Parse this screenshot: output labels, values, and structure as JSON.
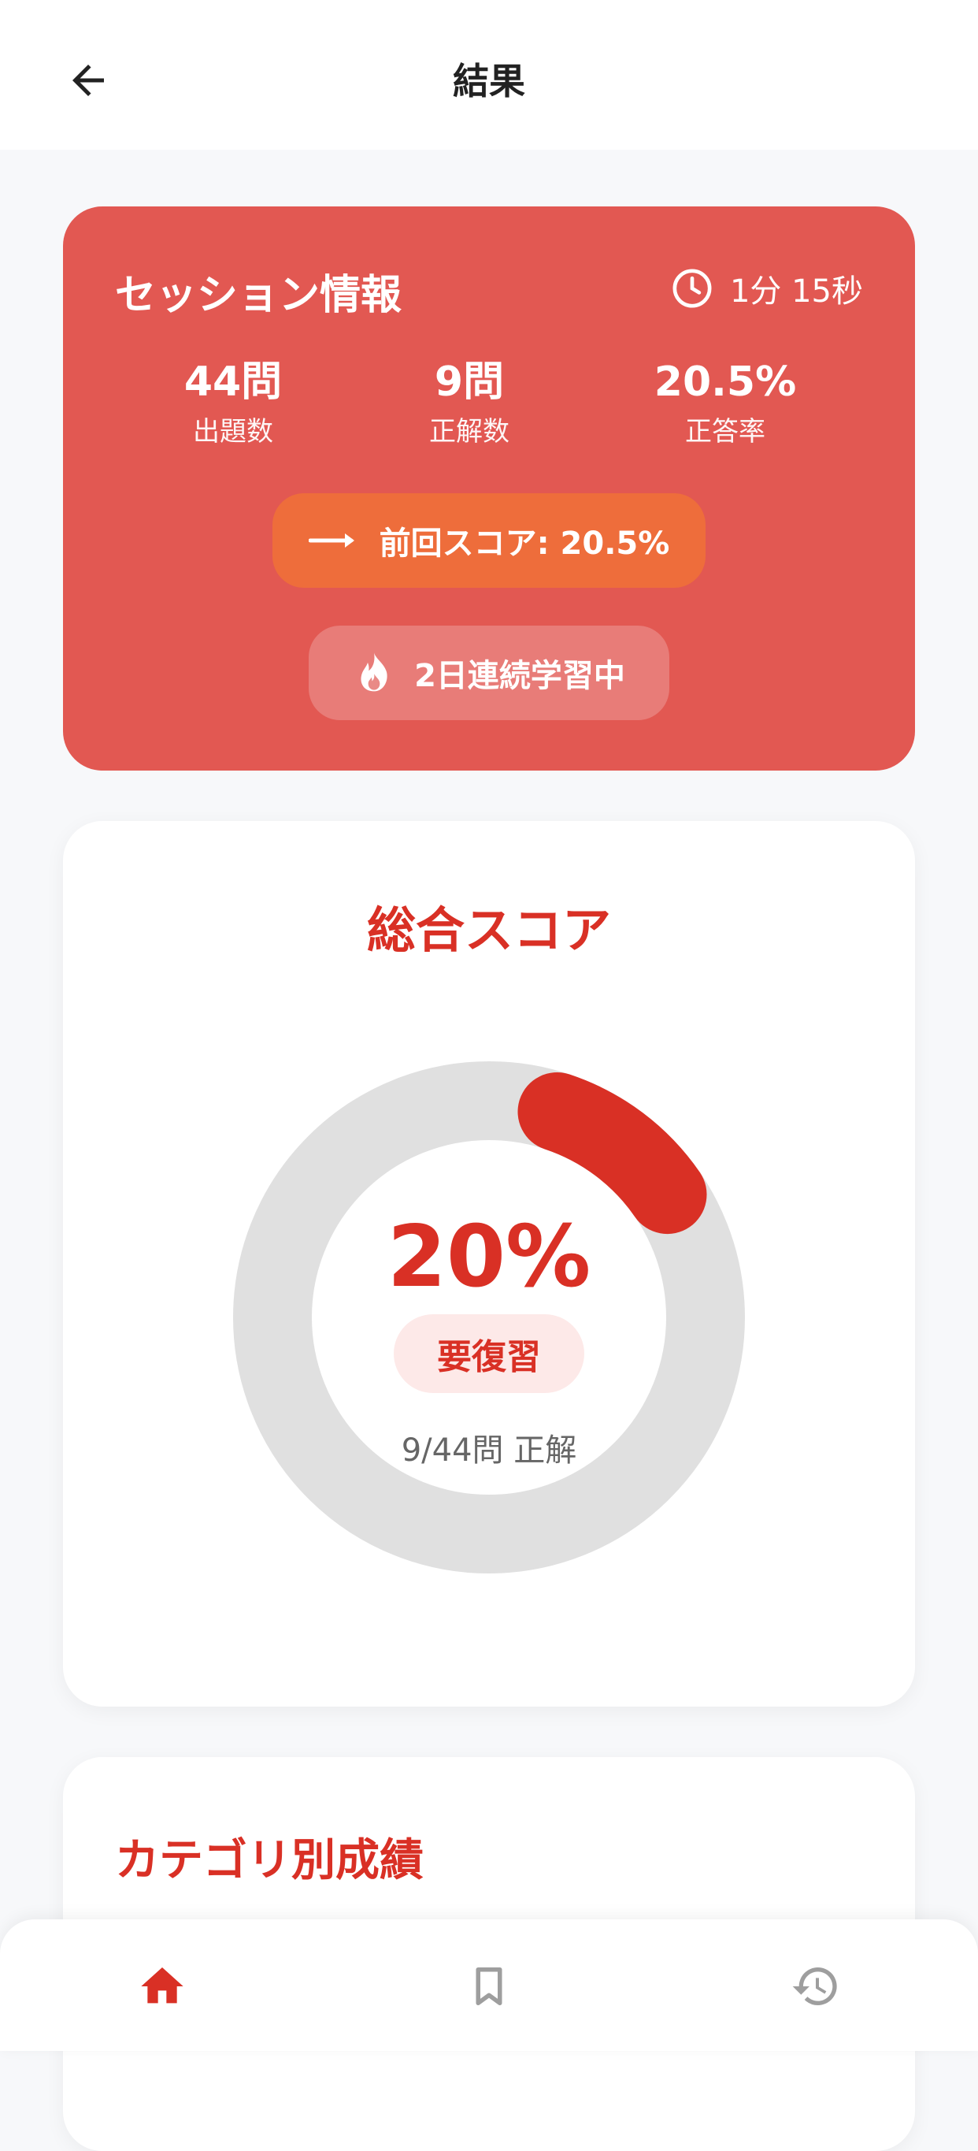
{
  "appbar": {
    "title": "結果"
  },
  "session": {
    "title": "セッション情報",
    "duration": "1分 15秒",
    "stats": [
      {
        "value": "44問",
        "label": "出題数"
      },
      {
        "value": "9問",
        "label": "正解数"
      },
      {
        "value": "20.5%",
        "label": "正答率"
      }
    ],
    "previous_score": "前回スコア: 20.5%",
    "streak": "2日連続学習中"
  },
  "score": {
    "title": "総合スコア",
    "percent": "20%",
    "progress_fraction": 0.205,
    "status": "要復習",
    "correct_summary": "9/44問 正解"
  },
  "category": {
    "title": "カテゴリ別成績"
  },
  "nav": {
    "items": [
      {
        "icon": "home-icon",
        "active": true
      },
      {
        "icon": "bookmark-icon",
        "active": false
      },
      {
        "icon": "history-icon",
        "active": false
      }
    ]
  },
  "colors": {
    "accent": "#D93025",
    "session_card": "#E25852",
    "previous_score_pill": "#EE6D3B",
    "gauge_track": "#E0E0E0",
    "inactive_icon": "#9E9E9E"
  }
}
